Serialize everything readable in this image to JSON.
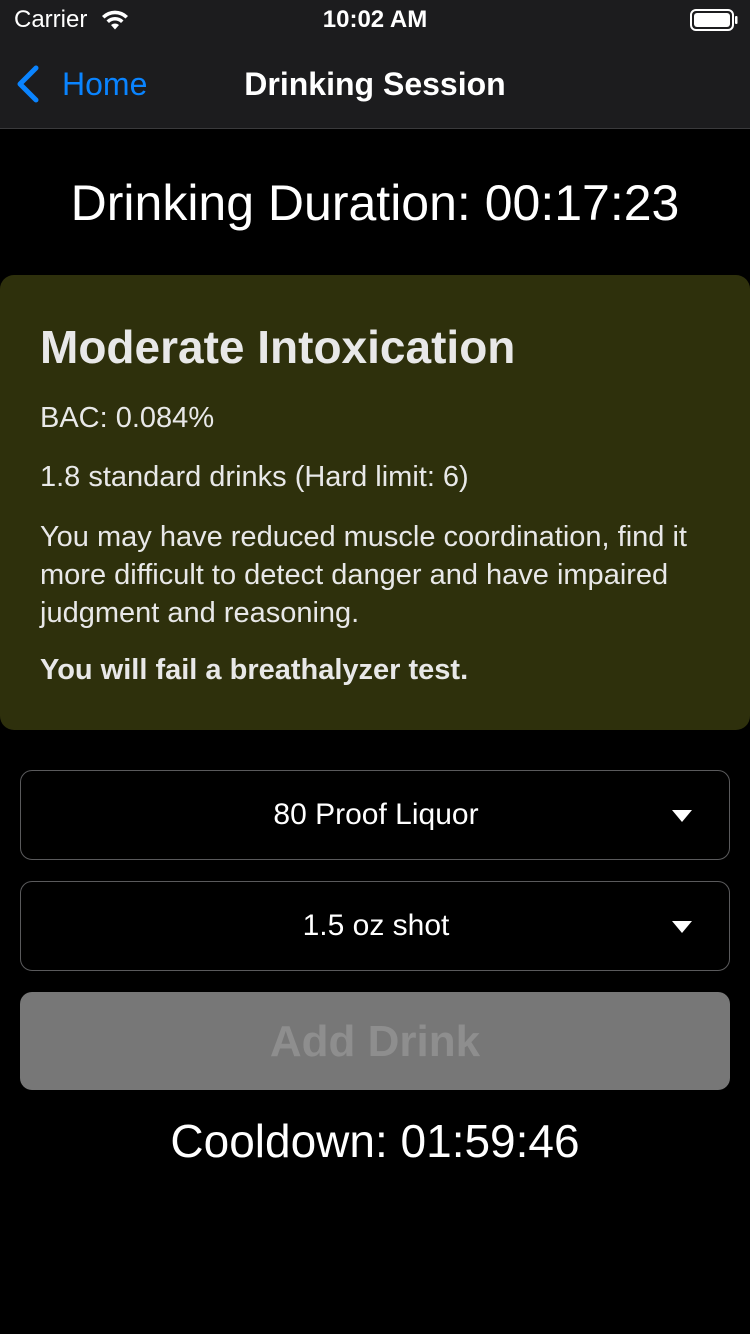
{
  "status_bar": {
    "carrier": "Carrier",
    "time": "10:02 AM",
    "icons": [
      "wifi-icon",
      "battery-icon"
    ]
  },
  "nav": {
    "back_label": "Home",
    "title": "Drinking Session",
    "back_icon": "chevron-left-icon"
  },
  "session": {
    "duration_text": "Drinking Duration: 00:17:23"
  },
  "status_card": {
    "title": "Moderate Intoxication",
    "bac": "BAC: 0.084%",
    "drinks": "1.8 standard drinks (Hard limit: 6)",
    "description": "You may have reduced muscle coordination, find it more difficult to detect danger and have impaired judgment and reasoning.",
    "warning": "You will fail a breathalyzer test.",
    "background_color": "#2e300c"
  },
  "drink_type": {
    "selected": "80 Proof Liquor"
  },
  "drink_size": {
    "selected": "1.5 oz shot"
  },
  "add_drink": {
    "label": "Add Drink",
    "disabled": true
  },
  "cooldown": {
    "text": "Cooldown: 01:59:46"
  },
  "colors": {
    "accent": "#0a84ff",
    "background": "#000000",
    "bar_background": "#1c1c1e",
    "button_disabled": "#777777"
  }
}
